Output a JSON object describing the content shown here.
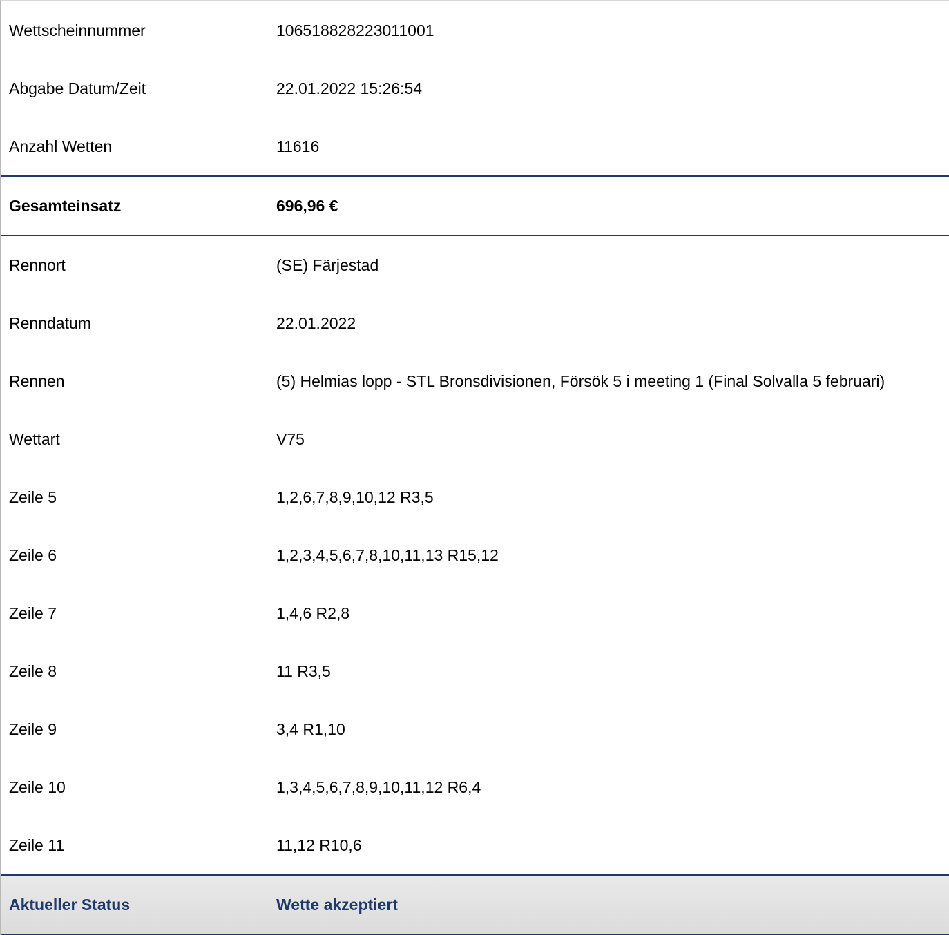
{
  "ticket": {
    "header_rows": [
      {
        "label": "Wettscheinnummer",
        "value": "106518828223011001"
      },
      {
        "label": "Abgabe Datum/Zeit",
        "value": "22.01.2022 15:26:54"
      },
      {
        "label": "Anzahl Wetten",
        "value": "11616"
      }
    ],
    "total": {
      "label": "Gesamteinsatz",
      "value": "696,96 €"
    },
    "race_rows": [
      {
        "label": "Rennort",
        "value": "(SE) Färjestad"
      },
      {
        "label": "Renndatum",
        "value": "22.01.2022"
      },
      {
        "label": "Rennen",
        "value": "(5) Helmias lopp - STL Bronsdivisionen, Försök 5 i meeting 1 (Final Solvalla 5 februari)"
      },
      {
        "label": "Wettart",
        "value": "V75"
      },
      {
        "label": "Zeile 5",
        "value": "1,2,6,7,8,9,10,12 R3,5"
      },
      {
        "label": "Zeile 6",
        "value": "1,2,3,4,5,6,7,8,10,11,13 R15,12"
      },
      {
        "label": "Zeile 7",
        "value": "1,4,6 R2,8"
      },
      {
        "label": "Zeile 8",
        "value": "11 R3,5"
      },
      {
        "label": "Zeile 9",
        "value": "3,4 R1,10"
      },
      {
        "label": "Zeile 10",
        "value": "1,3,4,5,6,7,8,9,10,11,12 R6,4"
      },
      {
        "label": "Zeile 11",
        "value": "11,12 R10,6"
      }
    ],
    "status": {
      "label": "Aktueller Status",
      "value": "Wette akzeptiert"
    }
  },
  "colors": {
    "accent_navy": "#1f3a6a",
    "status_background": "#e2e2e2",
    "text": "#000000"
  }
}
